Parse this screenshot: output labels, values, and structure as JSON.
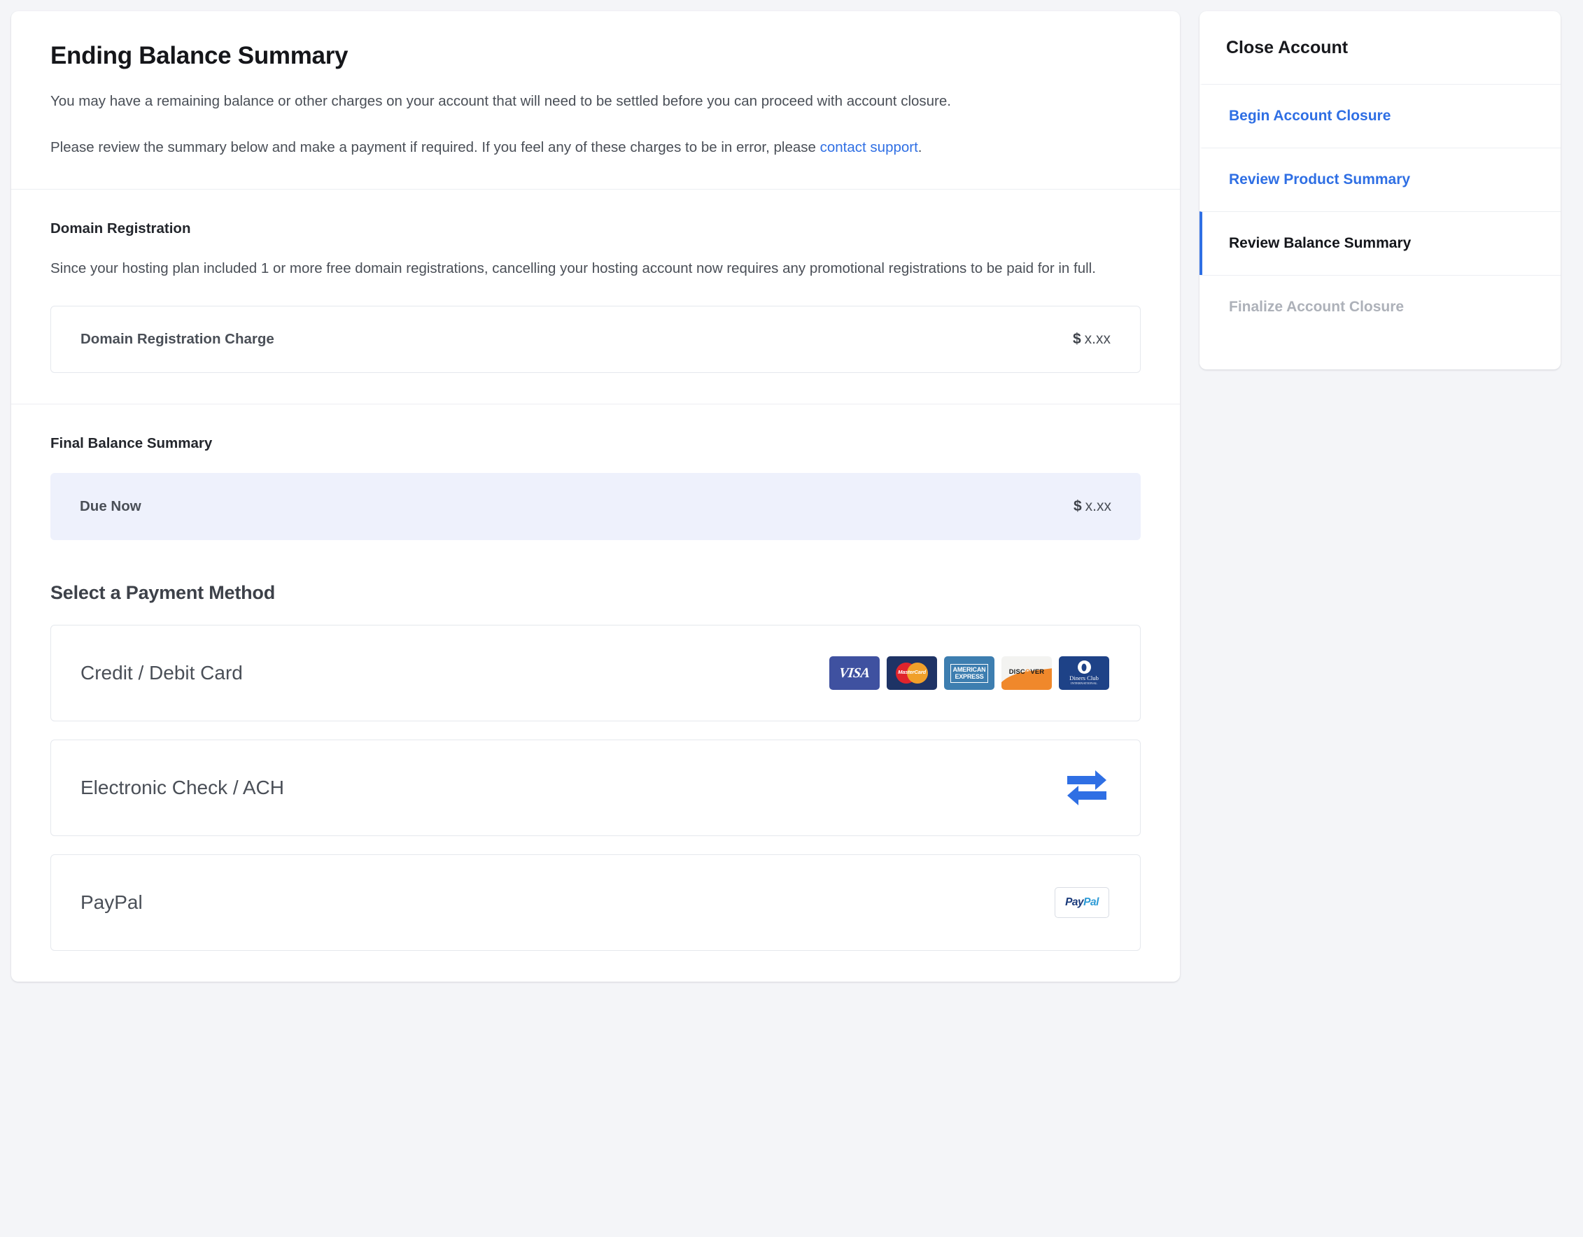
{
  "main": {
    "title": "Ending Balance Summary",
    "paragraph1": "You may have a remaining balance or other charges on your account that will need to be settled before you can proceed with account closure.",
    "paragraph2_pre": "Please review the summary below and make a payment if required. If you feel any of these charges to be in error, please ",
    "paragraph2_link": "contact support",
    "paragraph2_post": ".",
    "domain_section": {
      "heading": "Domain Registration",
      "body": "Since your hosting plan included 1 or more free domain registrations, cancelling your hosting account now requires any promotional registrations to be paid for in full.",
      "line_item": {
        "label": "Domain Registration Charge",
        "currency": "$",
        "amount": "x.xx"
      }
    },
    "balance_section": {
      "heading": "Final Balance Summary",
      "line_item": {
        "label": "Due Now",
        "currency": "$",
        "amount": "x.xx"
      }
    },
    "payment_section": {
      "heading": "Select a Payment Method",
      "options": [
        {
          "label": "Credit / Debit Card",
          "icon": "card-brand-logos",
          "brands": [
            "VISA",
            "MasterCard",
            "AMERICAN EXPRESS",
            "DISCOVER",
            "Diners Club INTERNATIONAL"
          ]
        },
        {
          "label": "Electronic Check / ACH",
          "icon": "exchange-arrows-icon"
        },
        {
          "label": "PayPal",
          "icon": "paypal-logo",
          "logo_text_a": "Pay",
          "logo_text_b": "Pal"
        }
      ]
    }
  },
  "sidebar": {
    "title": "Close Account",
    "items": [
      {
        "label": "Begin Account Closure",
        "state": "link"
      },
      {
        "label": "Review Product Summary",
        "state": "link"
      },
      {
        "label": "Review Balance Summary",
        "state": "active"
      },
      {
        "label": "Finalize Account Closure",
        "state": "disabled"
      }
    ]
  },
  "colors": {
    "page_background": "#f4f5f8",
    "card_background": "#ffffff",
    "accent_blue": "#2f6fe4",
    "highlight_row": "#eef1fc",
    "body_text": "#4a4f57",
    "muted_text": "#adb1b9",
    "border": "#e5e8ed"
  }
}
